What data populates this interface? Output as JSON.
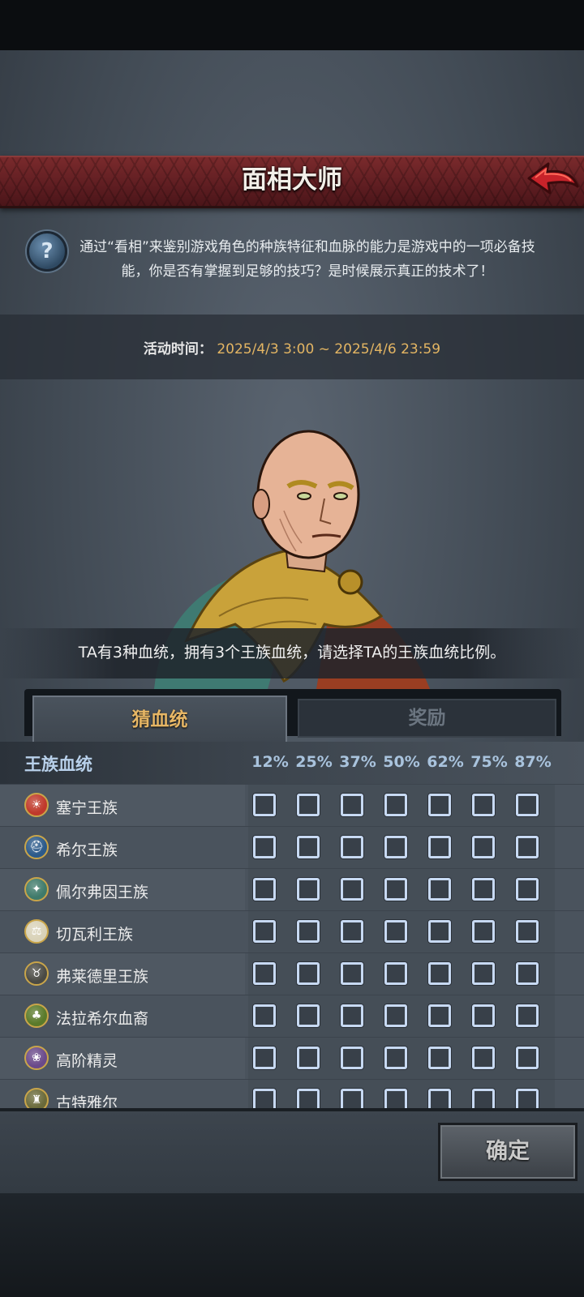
{
  "header": {
    "title": "面相大师"
  },
  "info": {
    "icon": "question-icon",
    "description": "通过“看相”来鉴别游戏角色的种族特征和血脉的能力是游戏中的一项必备技能，你是否有掌握到足够的技巧？是时候展示真正的技术了！"
  },
  "event_time": {
    "label": "活动时间：",
    "value": "2025/4/3 3:00 ~ 2025/4/6 23:59"
  },
  "question": "TA有3种血统，拥有3个王族血统，请选择TA的王族血统比例。",
  "tabs": [
    {
      "label": "猜血统",
      "active": true
    },
    {
      "label": "奖励",
      "active": false
    }
  ],
  "grid": {
    "header_label": "王族血统",
    "percentages": [
      "12%",
      "25%",
      "37%",
      "50%",
      "62%",
      "75%",
      "87%"
    ],
    "rows": [
      {
        "name": "塞宁王族",
        "emblem_color": "#c0392b",
        "icon": "sun-emblem-icon"
      },
      {
        "name": "希尔王族",
        "emblem_color": "#2c5a8a",
        "icon": "helm-emblem-icon"
      },
      {
        "name": "佩尔弗因王族",
        "emblem_color": "#3f7a6a",
        "icon": "wolf-emblem-icon"
      },
      {
        "name": "切瓦利王族",
        "emblem_color": "#d9d2b8",
        "icon": "scales-emblem-icon"
      },
      {
        "name": "弗莱德里王族",
        "emblem_color": "#4a4a44",
        "icon": "bull-emblem-icon"
      },
      {
        "name": "法拉希尔血裔",
        "emblem_color": "#5a7a2a",
        "icon": "tree-emblem-icon"
      },
      {
        "name": "高阶精灵",
        "emblem_color": "#6a4a8a",
        "icon": "elf-emblem-icon"
      },
      {
        "name": "古特雅尔",
        "emblem_color": "#6a6a3a",
        "icon": "tower-emblem-icon"
      }
    ]
  },
  "confirm_label": "确定",
  "colors": {
    "title_bar": "#5e1d21",
    "accent_gold": "#e3b563",
    "checkbox_border": "#c7d9f2",
    "back_arrow": "#c8232a"
  }
}
